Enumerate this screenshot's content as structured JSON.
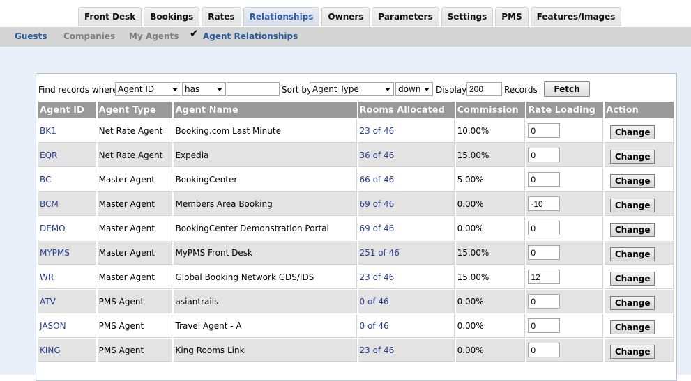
{
  "tabs": [
    {
      "label": "Front Desk"
    },
    {
      "label": "Bookings"
    },
    {
      "label": "Rates"
    },
    {
      "label": "Relationships",
      "active": true
    },
    {
      "label": "Owners"
    },
    {
      "label": "Parameters"
    },
    {
      "label": "Settings"
    },
    {
      "label": "PMS"
    },
    {
      "label": "Features/Images"
    }
  ],
  "subnav": {
    "guests": "Guests",
    "companies": "Companies",
    "my_agents": "My Agents",
    "agent_relationships": "Agent Relationships",
    "check_icon": "✔"
  },
  "filter": {
    "find_label": "Find records where",
    "field_value": "Agent ID",
    "operator_value": "has",
    "search_value": "",
    "sort_label": "Sort by",
    "sort_value": "Agent Type",
    "direction_value": "down",
    "display_label": "Display",
    "display_value": "200",
    "records_label": "Records",
    "fetch_label": "Fetch"
  },
  "table": {
    "headers": [
      "Agent ID",
      "Agent Type",
      "Agent Name",
      "Rooms Allocated",
      "Commission",
      "Rate Loading",
      "Action"
    ],
    "change_label": "Change",
    "rows": [
      {
        "id": "BK1",
        "type": "Net Rate Agent",
        "name": "Booking.com Last Minute",
        "rooms": "23 of 46",
        "commission": "10.00%",
        "rate": "0"
      },
      {
        "id": "EQR",
        "type": "Net Rate Agent",
        "name": "Expedia",
        "rooms": "36 of 46",
        "commission": "15.00%",
        "rate": "0"
      },
      {
        "id": "BC",
        "type": "Master Agent",
        "name": "BookingCenter",
        "rooms": "66 of 46",
        "commission": "5.00%",
        "rate": "0"
      },
      {
        "id": "BCM",
        "type": "Master Agent",
        "name": "Members Area Booking",
        "rooms": "69 of 46",
        "commission": "0.00%",
        "rate": "-10"
      },
      {
        "id": "DEMO",
        "type": "Master Agent",
        "name": "BookingCenter Demonstration Portal",
        "rooms": "69 of 46",
        "commission": "0.00%",
        "rate": "0"
      },
      {
        "id": "MYPMS",
        "type": "Master Agent",
        "name": "MyPMS Front Desk",
        "rooms": "251 of 46",
        "commission": "15.00%",
        "rate": "0"
      },
      {
        "id": "WR",
        "type": "Master Agent",
        "name": "Global Booking Network GDS/IDS",
        "rooms": "23 of 46",
        "commission": "15.00%",
        "rate": "12"
      },
      {
        "id": "ATV",
        "type": "PMS Agent",
        "name": "asiantrails",
        "rooms": "0 of 46",
        "commission": "0.00%",
        "rate": "0"
      },
      {
        "id": "JASON",
        "type": "PMS Agent",
        "name": "Travel Agent - A",
        "rooms": "0 of 46",
        "commission": "0.00%",
        "rate": "0"
      },
      {
        "id": "KING",
        "type": "PMS Agent",
        "name": "King Rooms Link",
        "rooms": "23 of 46",
        "commission": "0.00%",
        "rate": "0"
      }
    ]
  }
}
